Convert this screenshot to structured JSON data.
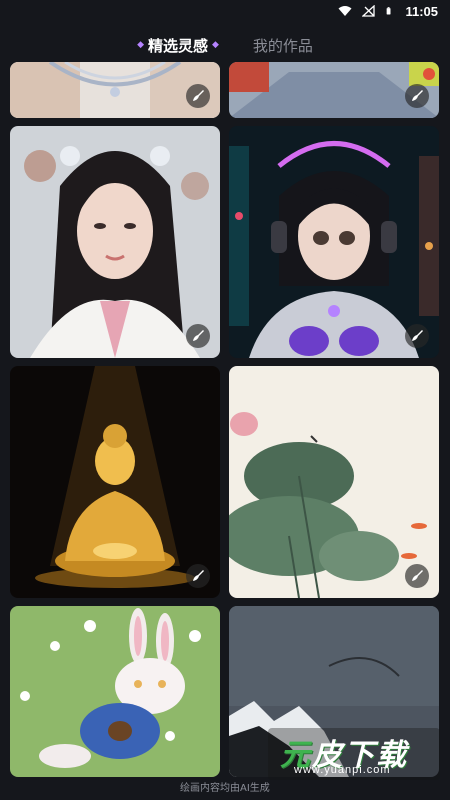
{
  "status": {
    "time": "11:05",
    "icons": [
      "wifi-icon",
      "no-signal-icon",
      "battery-icon"
    ]
  },
  "tabs": [
    {
      "label": "精选灵感",
      "active": true
    },
    {
      "label": "我的作品",
      "active": false
    }
  ],
  "cards": [
    {
      "subject": "ornate-necklace",
      "badge": "ai-brush-icon"
    },
    {
      "subject": "street-scene",
      "badge": "ai-brush-icon"
    },
    {
      "subject": "hanfu-woman-portrait",
      "badge": "ai-brush-icon"
    },
    {
      "subject": "cyberpunk-android-girl",
      "badge": "ai-brush-icon"
    },
    {
      "subject": "golden-buddha",
      "badge": "ai-brush-icon"
    },
    {
      "subject": "lotus-ink-painting",
      "badge": "ai-brush-icon"
    },
    {
      "subject": "white-rabbit-in-sweater",
      "badge": ""
    },
    {
      "subject": "misty-mountain-ink",
      "badge": ""
    }
  ],
  "footer": {
    "note": "绘画内容均由AI生成"
  },
  "watermark": {
    "title_a": "元",
    "title_b": "皮下载",
    "url": "www.yuanpi.com"
  },
  "colors": {
    "accent": "#b583ff",
    "background": "#15171c",
    "inactive": "#8a8d96"
  }
}
